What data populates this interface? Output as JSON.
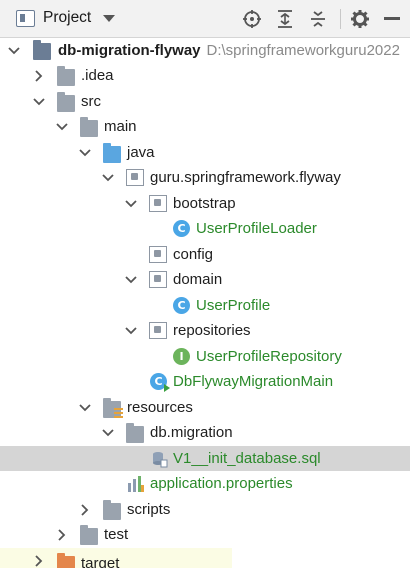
{
  "toolbar": {
    "title": "Project",
    "icons": [
      "project-view-icon",
      "dropdown-icon",
      "locate-icon",
      "expand-all-icon",
      "collapse-all-icon",
      "settings-icon",
      "hide-icon"
    ]
  },
  "colors": {
    "selected_row": "#d5d5d5",
    "class_icon": "#4aa6e6",
    "interface_icon": "#6cb45c",
    "resource_folder": "#e6a33a",
    "source_folder": "#5aa6e0",
    "excluded_folder": "#e4864b",
    "green_text": "#2b8a2b"
  },
  "tree": {
    "root_name": "db-migration-flyway",
    "root_path": "D:\\springframeworkguru2022",
    "idea": ".idea",
    "src": "src",
    "main": "main",
    "java": "java",
    "package": "guru.springframework.flyway",
    "bootstrap": "bootstrap",
    "user_profile_loader": "UserProfileLoader",
    "config": "config",
    "domain": "domain",
    "user_profile": "UserProfile",
    "repositories": "repositories",
    "user_profile_repository": "UserProfileRepository",
    "main_class": "DbFlywayMigrationMain",
    "resources": "resources",
    "db_migration": "db.migration",
    "sql_file": "V1__init_database.sql",
    "app_properties": "application.properties",
    "scripts": "scripts",
    "test": "test",
    "target": "target",
    "class_letter": "C",
    "interface_letter": "I"
  }
}
